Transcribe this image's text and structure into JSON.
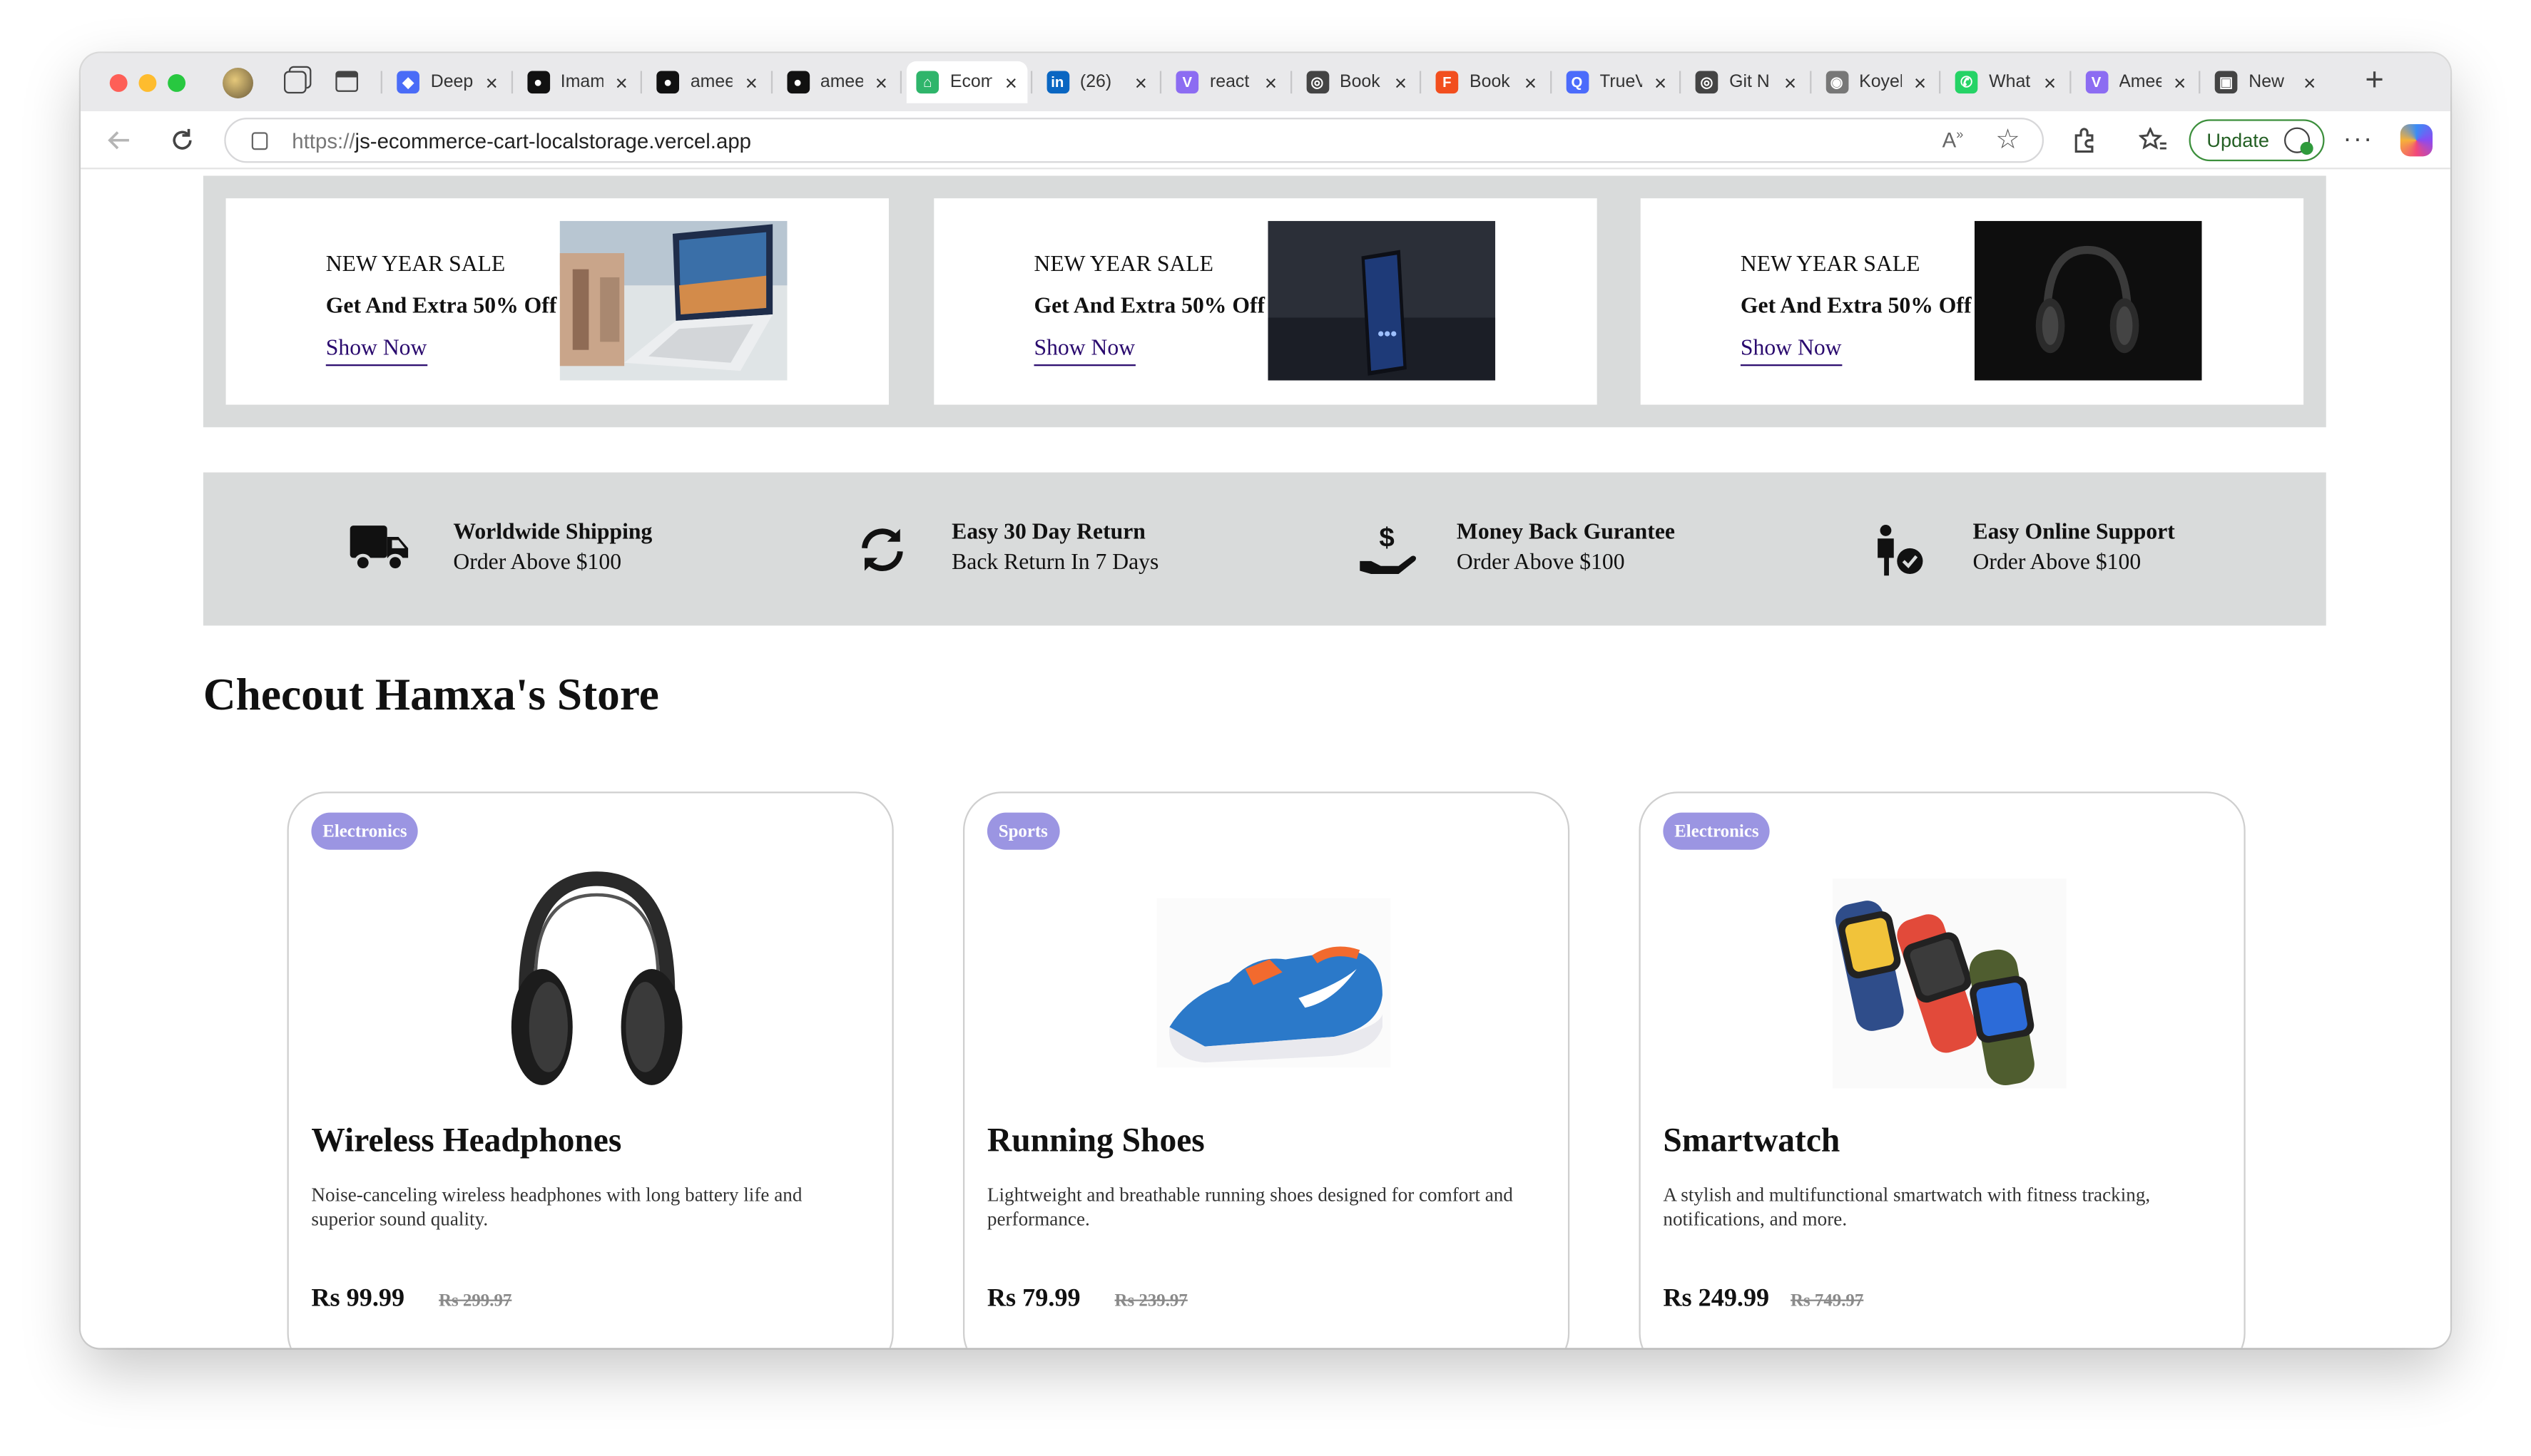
{
  "browser": {
    "tabs": [
      {
        "title": "Deep",
        "icon": "copilot-icon",
        "color": "#4a6cf7"
      },
      {
        "title": "Imam",
        "icon": "github-icon",
        "color": "#111111"
      },
      {
        "title": "amee",
        "icon": "github-icon",
        "color": "#111111"
      },
      {
        "title": "amee",
        "icon": "github-icon",
        "color": "#111111"
      },
      {
        "title": "Ecom",
        "icon": "cart-icon",
        "color": "#2fb56b",
        "active": true
      },
      {
        "title": "(26)",
        "icon": "linkedin-icon",
        "color": "#0a66c2"
      },
      {
        "title": "react",
        "icon": "vite-icon",
        "color": "#8c6cf2"
      },
      {
        "title": "Book",
        "icon": "globe-icon",
        "color": "#444444"
      },
      {
        "title": "Book",
        "icon": "figma-icon",
        "color": "#f24e1e"
      },
      {
        "title": "TrueV",
        "icon": "search-icon",
        "color": "#4b6bfb"
      },
      {
        "title": "Git N",
        "icon": "globe-icon",
        "color": "#444444"
      },
      {
        "title": "Koyel",
        "icon": "koyeb-icon",
        "color": "#777777"
      },
      {
        "title": "What",
        "icon": "whatsapp-icon",
        "color": "#25d366"
      },
      {
        "title": "Amee",
        "icon": "vite-icon",
        "color": "#8c6cf2"
      },
      {
        "title": "New",
        "icon": "newtab-icon",
        "color": "#444444"
      }
    ],
    "url_protocol": "https://",
    "url_host": "js-ecommerce-cart-localstorage.vercel.app",
    "update_label": "Update"
  },
  "promos": [
    {
      "title": "NEW YEAR SALE",
      "subtitle": "Get And Extra 50% Off",
      "link": "Show Now",
      "image": "laptop-image"
    },
    {
      "title": "NEW YEAR SALE",
      "subtitle": "Get And Extra 50% Off",
      "link": "Show Now",
      "image": "phone-image"
    },
    {
      "title": "NEW YEAR SALE",
      "subtitle": "Get And Extra 50% Off",
      "link": "Show Now",
      "image": "headphones-image"
    }
  ],
  "features": [
    {
      "title": "Worldwide Shipping",
      "subtitle": "Order Above $100",
      "icon": "truck-icon"
    },
    {
      "title": "Easy 30 Day Return",
      "subtitle": "Back Return In 7 Days",
      "icon": "refresh-icon"
    },
    {
      "title": "Money Back Gurantee",
      "subtitle": "Order Above $100",
      "icon": "money-hand-icon"
    },
    {
      "title": "Easy Online Support",
      "subtitle": "Order Above $100",
      "icon": "support-person-icon"
    }
  ],
  "store_heading": "Checout Hamxa's Store",
  "products": [
    {
      "category": "Electronics",
      "name": "Wireless Headphones",
      "description": "Noise-canceling wireless headphones with long battery life and superior sound quality.",
      "price": "Rs 99.99",
      "original_price": "Rs 299.97",
      "image": "headphones-product"
    },
    {
      "category": "Sports",
      "name": "Running Shoes",
      "description": "Lightweight and breathable running shoes designed for comfort and performance.",
      "price": "Rs 79.99",
      "original_price": "Rs 239.97",
      "image": "shoe-product"
    },
    {
      "category": "Electronics",
      "name": "Smartwatch",
      "description": "A stylish and multifunctional smartwatch with fitness tracking, notifications, and more.",
      "price": "Rs 249.99",
      "original_price": "Rs 749.97",
      "image": "smartwatch-product"
    }
  ],
  "colors": {
    "badge": "#9b95e2",
    "panel": "#d9dbdb",
    "link": "#2a0a6e"
  }
}
